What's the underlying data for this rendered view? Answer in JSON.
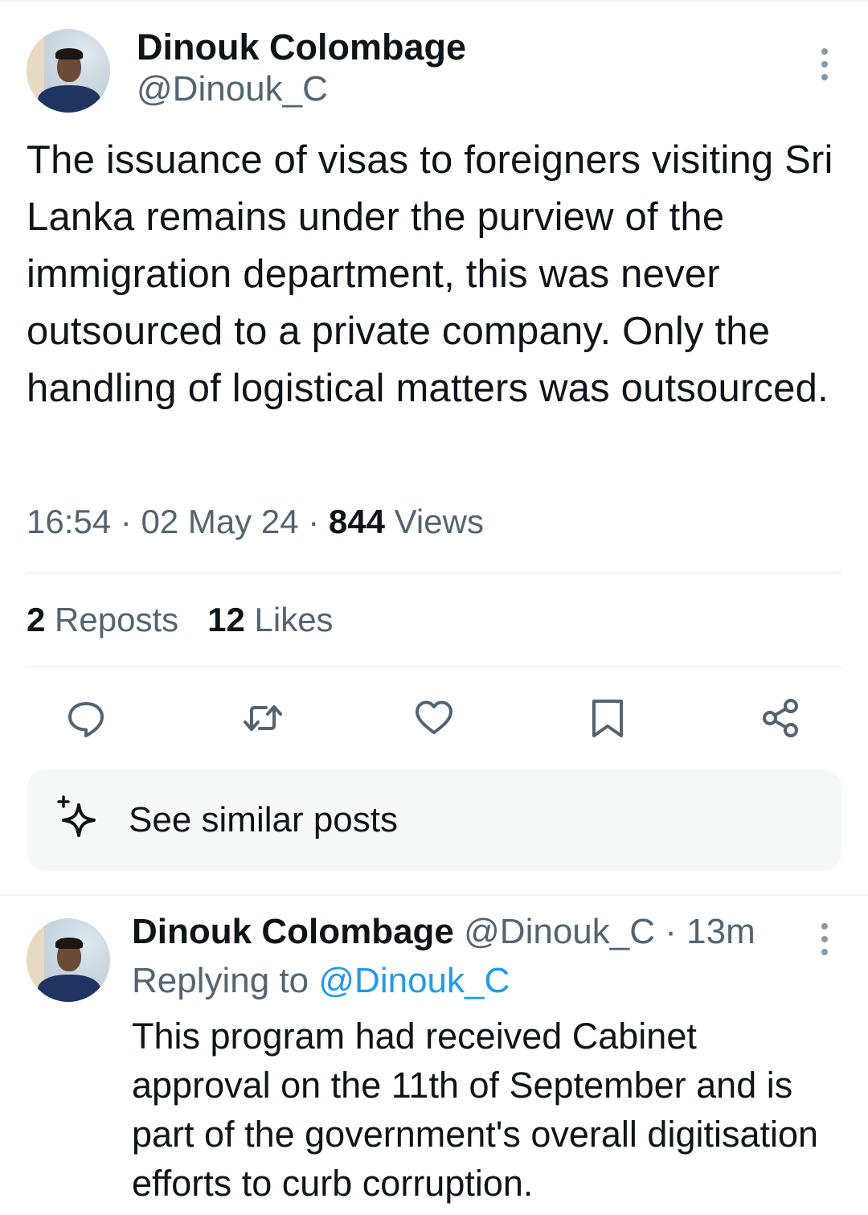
{
  "main_tweet": {
    "author_name": "Dinouk Colombage",
    "author_handle": "@Dinouk_C",
    "text": "The issuance of visas to foreigners visiting Sri Lanka remains under the purview of the immigration department, this was never outsourced to a private company. Only the handling of logistical matters was outsourced.",
    "time": "16:54",
    "date": "02 May 24",
    "separator": "·",
    "views_count": "844",
    "views_label": "Views",
    "reposts_count": "2",
    "reposts_label": "Reposts",
    "likes_count": "12",
    "likes_label": "Likes"
  },
  "actions": {
    "reply_icon": "speech-bubble-icon",
    "repost_icon": "repost-arrows-icon",
    "like_icon": "heart-icon",
    "bookmark_icon": "bookmark-icon",
    "share_icon": "share-icon"
  },
  "similar_posts": {
    "label": "See similar posts",
    "icon": "sparkle-icon"
  },
  "reply_tweet": {
    "author_name": "Dinouk Colombage",
    "author_handle": "@Dinouk_C",
    "separator": "·",
    "time_ago": "13m",
    "replying_prefix": "Replying to",
    "replying_handle": "@Dinouk_C",
    "text": "This program had received Cabinet approval on the 11th of September and is part of the government's overall digitisation efforts to curb corruption."
  },
  "colors": {
    "text_primary": "#0f1419",
    "text_secondary": "#536471",
    "link": "#1d9bf0",
    "divider": "#eff3f4",
    "card_bg": "#f7f9f9"
  }
}
